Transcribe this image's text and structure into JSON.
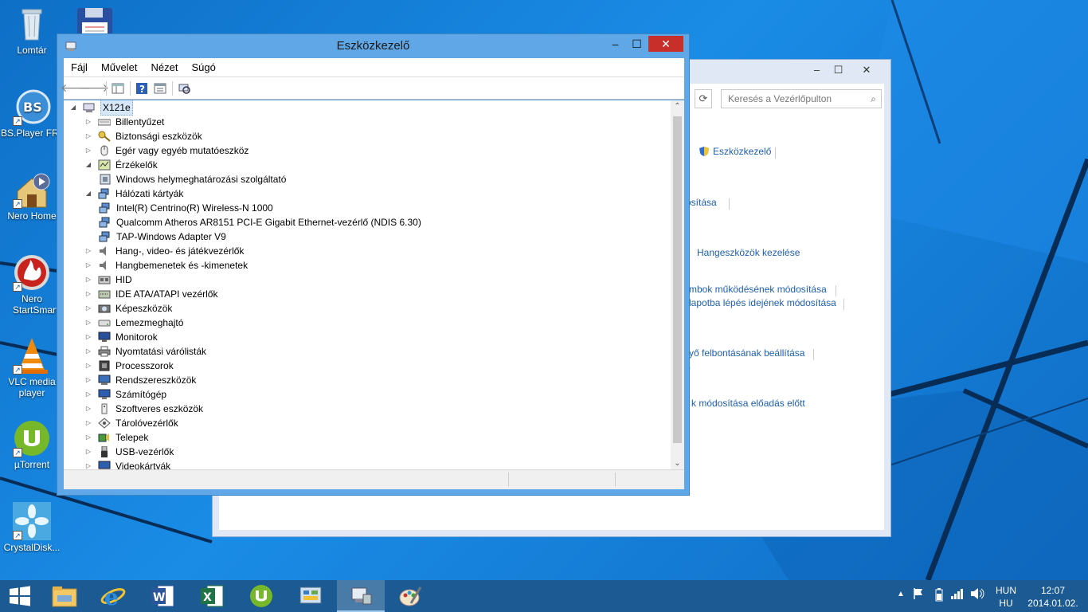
{
  "desktop": {
    "icons": [
      {
        "label": "Lomtár"
      },
      {
        "label": ""
      },
      {
        "label": "BS.Player FREE"
      },
      {
        "label": "Nero Home"
      },
      {
        "label": "Nero StartSmart"
      },
      {
        "label": "VLC media player"
      },
      {
        "label": "µTorrent"
      },
      {
        "label": "CrystalDisk..."
      }
    ]
  },
  "control_panel": {
    "search_placeholder": "Keresés a Vezérlőpulton",
    "links": [
      "Eszközkezelő",
      "ósítása",
      "Hangeszközök kezelése",
      "mbok működésének módosítása",
      "lapotba lépés idejének módosítása",
      "yő felbontásának beállítása",
      ")",
      "k módosítása előadás előtt"
    ]
  },
  "window": {
    "title": "Eszközkezelő",
    "menu": [
      "Fájl",
      "Művelet",
      "Nézet",
      "Súgó"
    ],
    "root": "X121e",
    "tree": [
      {
        "label": "Billentyűzet",
        "state": "collapsed",
        "icon": "keyboard-icon"
      },
      {
        "label": "Biztonsági eszközök",
        "state": "collapsed",
        "icon": "key-icon"
      },
      {
        "label": "Egér vagy egyéb mutatóeszköz",
        "state": "collapsed",
        "icon": "mouse-icon"
      },
      {
        "label": "Érzékelők",
        "state": "expanded",
        "icon": "sensor-icon"
      },
      {
        "label": "Windows helymeghatározási szolgáltató",
        "state": "child",
        "icon": "device-icon"
      },
      {
        "label": "Hálózati kártyák",
        "state": "expanded",
        "icon": "network-icon"
      },
      {
        "label": "Intel(R) Centrino(R) Wireless-N 1000",
        "state": "child",
        "icon": "network-icon"
      },
      {
        "label": "Qualcomm Atheros AR8151 PCI-E Gigabit Ethernet-vezérlő (NDIS 6.30)",
        "state": "child",
        "icon": "network-icon"
      },
      {
        "label": "TAP-Windows Adapter V9",
        "state": "child",
        "icon": "network-icon"
      },
      {
        "label": "Hang-, video- és játékvezérlők",
        "state": "collapsed",
        "icon": "speaker-icon"
      },
      {
        "label": "Hangbemenetek és -kimenetek",
        "state": "collapsed",
        "icon": "speaker-icon"
      },
      {
        "label": "HID",
        "state": "collapsed",
        "icon": "hid-icon"
      },
      {
        "label": "IDE ATA/ATAPI vezérlők",
        "state": "collapsed",
        "icon": "ide-icon"
      },
      {
        "label": "Képeszközök",
        "state": "collapsed",
        "icon": "camera-icon"
      },
      {
        "label": "Lemezmeghajtó",
        "state": "collapsed",
        "icon": "disk-icon"
      },
      {
        "label": "Monitorok",
        "state": "collapsed",
        "icon": "monitor-icon"
      },
      {
        "label": "Nyomtatási várólisták",
        "state": "collapsed",
        "icon": "printer-icon"
      },
      {
        "label": "Processzorok",
        "state": "collapsed",
        "icon": "cpu-icon"
      },
      {
        "label": "Rendszereszközök",
        "state": "collapsed",
        "icon": "system-icon"
      },
      {
        "label": "Számítógép",
        "state": "collapsed",
        "icon": "computer-icon"
      },
      {
        "label": "Szoftveres eszközök",
        "state": "collapsed",
        "icon": "software-icon"
      },
      {
        "label": "Tárolóvezérlők",
        "state": "collapsed",
        "icon": "storage-icon"
      },
      {
        "label": "Telepek",
        "state": "collapsed",
        "icon": "battery-icon"
      },
      {
        "label": "USB-vezérlők",
        "state": "collapsed",
        "icon": "usb-icon"
      },
      {
        "label": "Videokártyák",
        "state": "collapsed",
        "icon": "display-adapter-icon"
      }
    ]
  },
  "taskbar": {
    "lang_top": "HUN",
    "lang_bottom": "HU",
    "time": "12:07",
    "date": "2014.01.02."
  }
}
